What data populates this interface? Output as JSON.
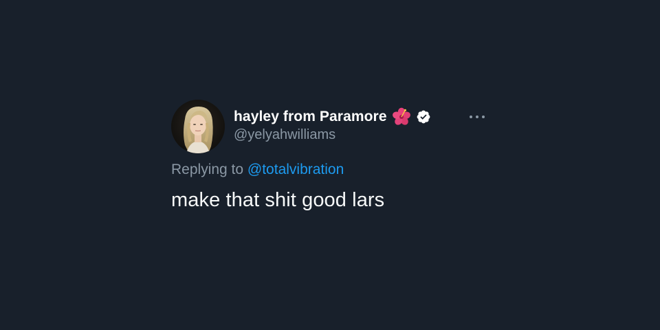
{
  "tweet": {
    "author": {
      "display_name": "hayley from Paramore",
      "name_emoji_icon": "hibiscus-icon",
      "verified_icon": "verified-badge-icon",
      "handle": "@yelyahwilliams",
      "avatar": "avatar-photo"
    },
    "more_icon": "more-options-icon",
    "replying_to_label": "Replying to",
    "replying_to_handle": "@totalvibration",
    "text": "make that shit good lars"
  },
  "colors": {
    "background": "#18202b",
    "text_primary": "#ffffff",
    "text_secondary": "#8b98a5",
    "link": "#1d9bf0"
  }
}
